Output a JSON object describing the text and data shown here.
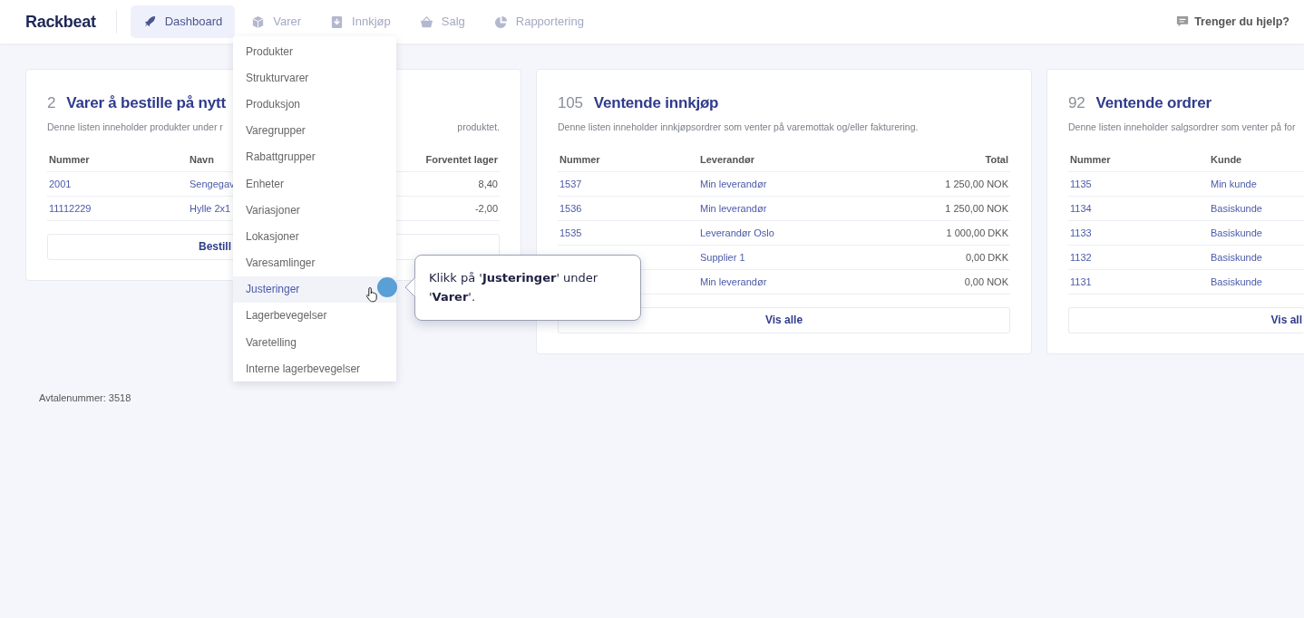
{
  "navbar": {
    "logo": "Rackbeat",
    "tabs": [
      {
        "label": "Dashboard",
        "selected": true
      },
      {
        "label": "Varer",
        "selected": false
      },
      {
        "label": "Innkjøp",
        "selected": false
      },
      {
        "label": "Salg",
        "selected": false
      },
      {
        "label": "Rapportering",
        "selected": false
      }
    ],
    "help": "Trenger du hjelp?"
  },
  "cards": [
    {
      "count": "2",
      "title": "Varer å bestille på nytt",
      "description_parts": [
        "Denne listen inneholder produkter under r",
        "produktet."
      ],
      "columns": [
        "Nummer",
        "Navn",
        "Forventet lager"
      ],
      "rows": [
        [
          "2001",
          "Sengegav",
          "8,40"
        ],
        [
          "11112229",
          "Hylle 2x1",
          "-2,00"
        ]
      ],
      "button": "Bestill",
      "cut": false
    },
    {
      "count": "105",
      "title": "Ventende innkjøp",
      "description_parts": [
        "Denne listen inneholder innkjøpsordrer som venter på varemottak og/eller fakturering."
      ],
      "columns": [
        "Nummer",
        "Leverandør",
        "Total"
      ],
      "rows": [
        [
          "1537",
          "Min leverandør",
          "1 250,00 NOK"
        ],
        [
          "1536",
          "Min leverandør",
          "1 250,00 NOK"
        ],
        [
          "1535",
          "Leverandør Oslo",
          "1 000,00 DKK"
        ],
        [
          null,
          "Supplier 1",
          "0,00 DKK"
        ],
        [
          null,
          "Min leverandør",
          "0,00 NOK"
        ]
      ],
      "button": "Vis alle",
      "cut": false
    },
    {
      "count": "92",
      "title": "Ventende ordrer",
      "description_parts": [
        "Denne listen inneholder salgsordrer som venter på for"
      ],
      "columns": [
        "Nummer",
        "Kunde"
      ],
      "rows": [
        [
          "1135",
          "Min kunde"
        ],
        [
          "1134",
          "Basiskunde"
        ],
        [
          "1133",
          "Basiskunde"
        ],
        [
          "1132",
          "Basiskunde"
        ],
        [
          "1131",
          "Basiskunde"
        ]
      ],
      "button": "Vis all",
      "cut": true
    }
  ],
  "dropdown": {
    "items": [
      {
        "label": "Produkter",
        "selected": false
      },
      {
        "label": "Strukturvarer",
        "selected": false
      },
      {
        "label": "Produksjon",
        "selected": false
      },
      {
        "label": "Varegrupper",
        "selected": false
      },
      {
        "label": "Rabattgrupper",
        "selected": false
      },
      {
        "label": "Enheter",
        "selected": false
      },
      {
        "label": "Variasjoner",
        "selected": false
      },
      {
        "label": "Lokasjoner",
        "selected": false
      },
      {
        "label": "Varesamlinger",
        "selected": false
      },
      {
        "label": "Justeringer",
        "selected": true
      },
      {
        "label": "Lagerbevegelser",
        "selected": false
      },
      {
        "label": "Varetelling",
        "selected": false
      },
      {
        "label": "Interne lagerbevegelser",
        "selected": false
      }
    ]
  },
  "tooltip": {
    "text": "Klikk på '**Justeringer**' under '**Varer**'."
  },
  "footer": "Avtalenummer: 3518"
}
